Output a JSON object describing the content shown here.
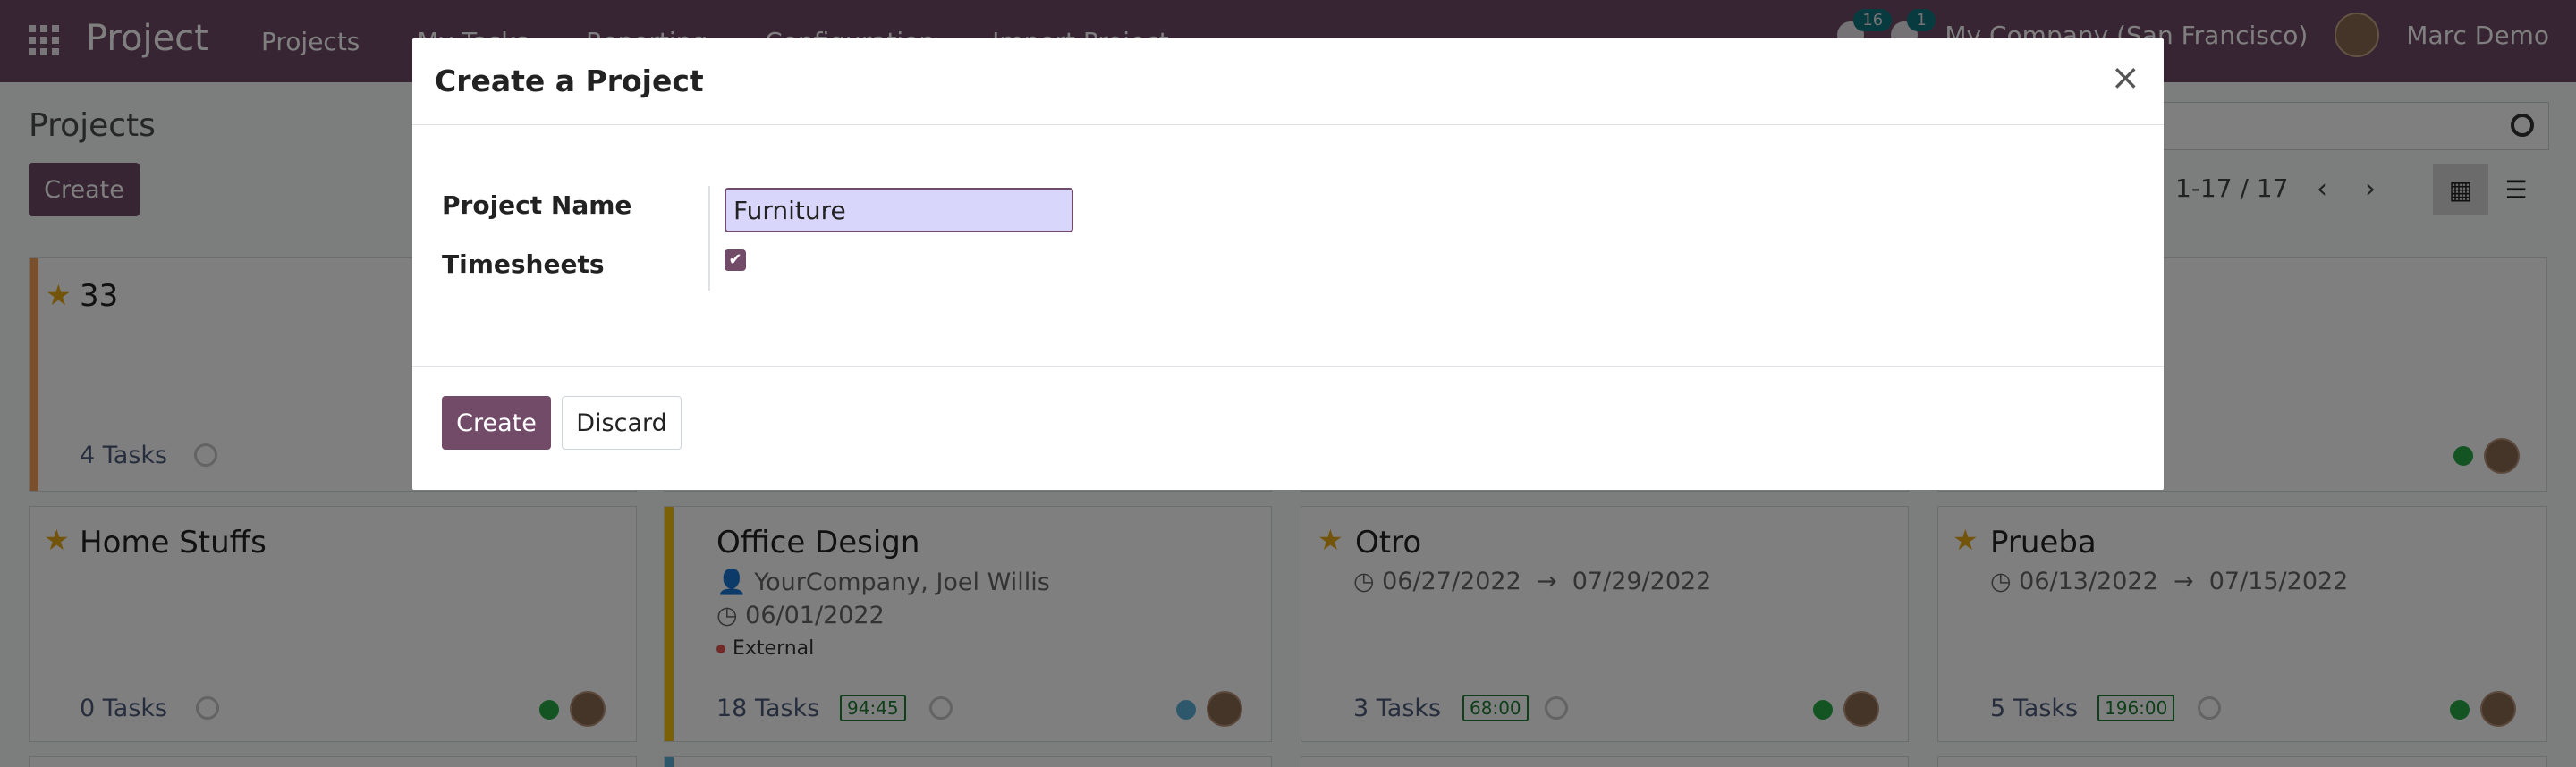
{
  "navbar": {
    "brand": "Project",
    "menu": [
      "Projects",
      "My Tasks",
      "Reporting",
      "Configuration",
      "Import Project"
    ],
    "messages_count": "16",
    "activities_count": "1",
    "company": "My Company (San Francisco)",
    "user": "Marc Demo"
  },
  "control_panel": {
    "title": "Projects",
    "create_label": "Create",
    "pager": "1-17 / 17"
  },
  "cards": [
    {
      "title": "33",
      "tasks": "4 Tasks",
      "starred": true
    },
    {
      "title": "Home Stuffs",
      "tasks": "0 Tasks",
      "starred": true
    },
    {
      "title": "Office Design",
      "owner": "YourCompany, Joel Willis",
      "date": "06/01/2022",
      "tag": "External",
      "tasks": "18 Tasks",
      "hours": "94:45",
      "starred": false
    },
    {
      "title": "Otro",
      "date_start": "06/27/2022",
      "date_end": "07/29/2022",
      "tasks": "3 Tasks",
      "hours": "68:00",
      "starred": true
    },
    {
      "title": "Prueba",
      "date_start": "06/13/2022",
      "date_end": "07/15/2022",
      "tasks": "5 Tasks",
      "hours": "196:00",
      "starred": true
    }
  ],
  "modal": {
    "title": "Create a Project",
    "close_glyph": "×",
    "project_name_label": "Project Name",
    "project_name_value": "Furniture",
    "timesheets_label": "Timesheets",
    "timesheets_checked": true,
    "create_label": "Create",
    "discard_label": "Discard"
  },
  "colors": {
    "brand": "#714b67",
    "star": "#e6a817",
    "status_green": "#28a745",
    "status_blue": "#5bb0d9"
  }
}
